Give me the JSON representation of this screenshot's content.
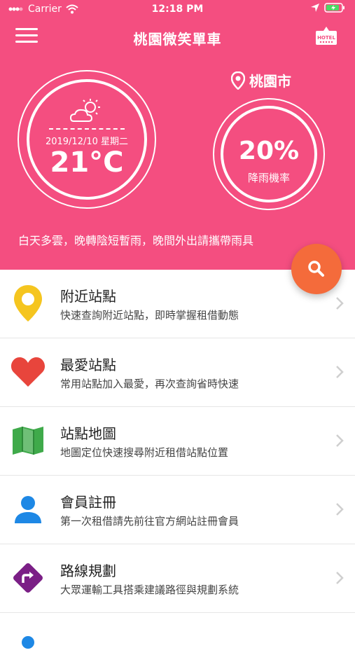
{
  "status_bar": {
    "carrier": "Carrier",
    "time": "12:18 PM"
  },
  "nav": {
    "title": "桃園微笑單車",
    "hotel_icon_text": "HOTEL"
  },
  "weather": {
    "date": "2019/12/10 星期二",
    "temperature": "21°C",
    "icon": "partly-cloudy-icon"
  },
  "rain": {
    "city": "桃園市",
    "percent": "20%",
    "label": "降雨機率"
  },
  "forecast_text": "白天多雲，晚轉陰短暫雨，晚間外出請攜帶雨具",
  "colors": {
    "header": "#f44e80",
    "fab": "#f46b3b",
    "pin_yellow": "#f5c51f",
    "heart": "#e8453c",
    "map": "#3faa4a",
    "member": "#1e88e5",
    "route": "#7b1f86"
  },
  "menu": [
    {
      "title": "附近站點",
      "desc": "快速查詢附近站點，即時掌握租借動態",
      "icon": "location-pin-icon"
    },
    {
      "title": "最愛站點",
      "desc": "常用站點加入最愛，再次查詢省時快速",
      "icon": "heart-icon"
    },
    {
      "title": "站點地圖",
      "desc": "地圖定位快速搜尋附近租借站點位置",
      "icon": "map-icon"
    },
    {
      "title": "會員註冊",
      "desc": "第一次租借請先前往官方網站註冊會員",
      "icon": "person-icon"
    },
    {
      "title": "路線規劃",
      "desc": "大眾運輸工具搭乘建議路徑與規劃系統",
      "icon": "route-sign-icon"
    }
  ]
}
